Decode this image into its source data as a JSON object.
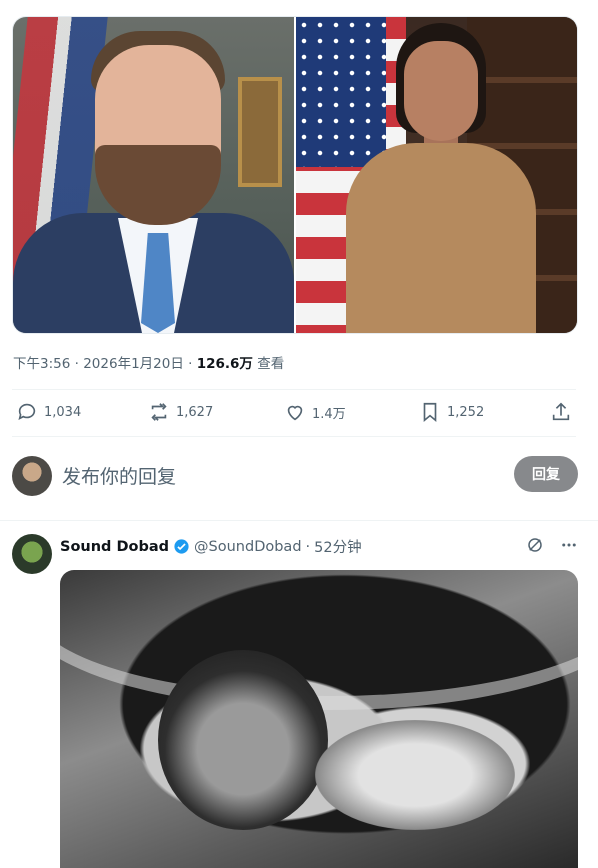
{
  "tweet": {
    "time": "下午3:56",
    "separator": "·",
    "date": "2026年1月20日",
    "views_count": "126.6万",
    "views_label": "查看"
  },
  "actions": {
    "replies": "1,034",
    "retweets": "1,627",
    "likes": "1.4万",
    "bookmarks": "1,252"
  },
  "reply_box": {
    "placeholder": "发布你的回复",
    "button_label": "回复"
  },
  "reply_tweet": {
    "display_name": "Sound Dobad",
    "handle": "@SoundDobad",
    "dot": "·",
    "time_ago": "52分钟"
  },
  "colors": {
    "verified": "#1d9bf0",
    "reply_button": "#87898c",
    "muted_text": "#536471"
  }
}
